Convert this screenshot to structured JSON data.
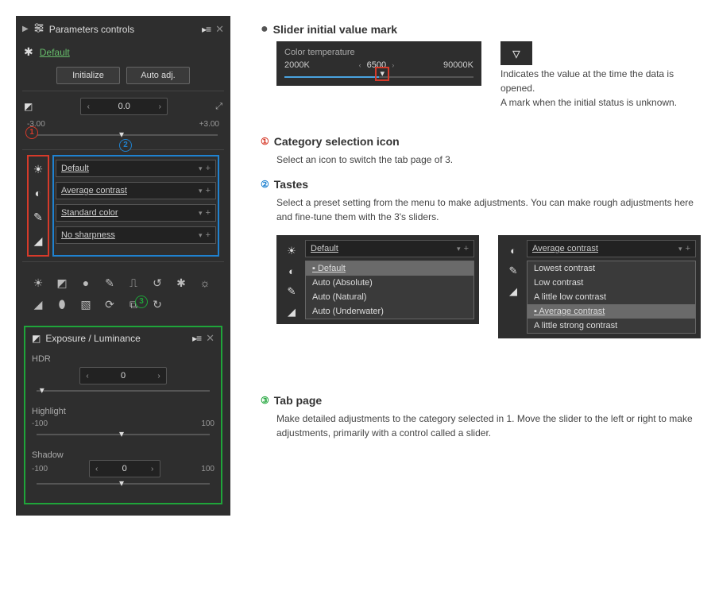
{
  "panel": {
    "title": "Parameters controls",
    "preset": "Default",
    "buttons": {
      "init": "Initialize",
      "auto": "Auto adj."
    },
    "exposure": {
      "value": "0.0",
      "min": "-3.00",
      "max": "+3.00"
    },
    "tastes": [
      {
        "icon": "sun-icon",
        "label": "Default"
      },
      {
        "icon": "contrast-icon",
        "label": "Average contrast"
      },
      {
        "icon": "eyedropper-icon",
        "label": "Standard color"
      },
      {
        "icon": "sharpness-icon",
        "label": "No sharpness"
      }
    ],
    "tabpage": {
      "title": "Exposure / Luminance",
      "controls": [
        {
          "label": "HDR",
          "value": "0",
          "min": "",
          "max": ""
        },
        {
          "label": "Highlight",
          "value": "",
          "min": "-100",
          "max": "100"
        },
        {
          "label": "Shadow",
          "value": "0",
          "min": "-100",
          "max": "100"
        }
      ]
    }
  },
  "badges": {
    "one": "1",
    "two": "2",
    "three": "3"
  },
  "doc": {
    "h_mark": "Slider initial value mark",
    "mark_text1": "Indicates the value at the time the data is opened.",
    "mark_text2": "A mark when the initial status is unknown.",
    "ct": {
      "title": "Color temperature",
      "min": "2000K",
      "value": "6500",
      "max": "90000K"
    },
    "h_cat": "Category selection icon",
    "cat_text": "Select an icon to switch the tab page of 3.",
    "h_tastes": "Tastes",
    "tastes_text": "Select a preset setting from the menu to make adjustments. You can make rough adjustments here and fine-tune them with the 3's sliders.",
    "dd1": {
      "header": "Default",
      "items": [
        "Default",
        "Auto (Absolute)",
        "Auto (Natural)",
        "Auto (Underwater)"
      ]
    },
    "dd2": {
      "header": "Average contrast",
      "items": [
        "Lowest contrast",
        "Low contrast",
        "A little low contrast",
        "Average contrast",
        "A little strong contrast"
      ]
    },
    "h_tab": "Tab page",
    "tab_text": "Make detailed adjustments to the category selected in 1. Move the slider to the left or right to make adjustments, primarily with a control called a slider."
  }
}
